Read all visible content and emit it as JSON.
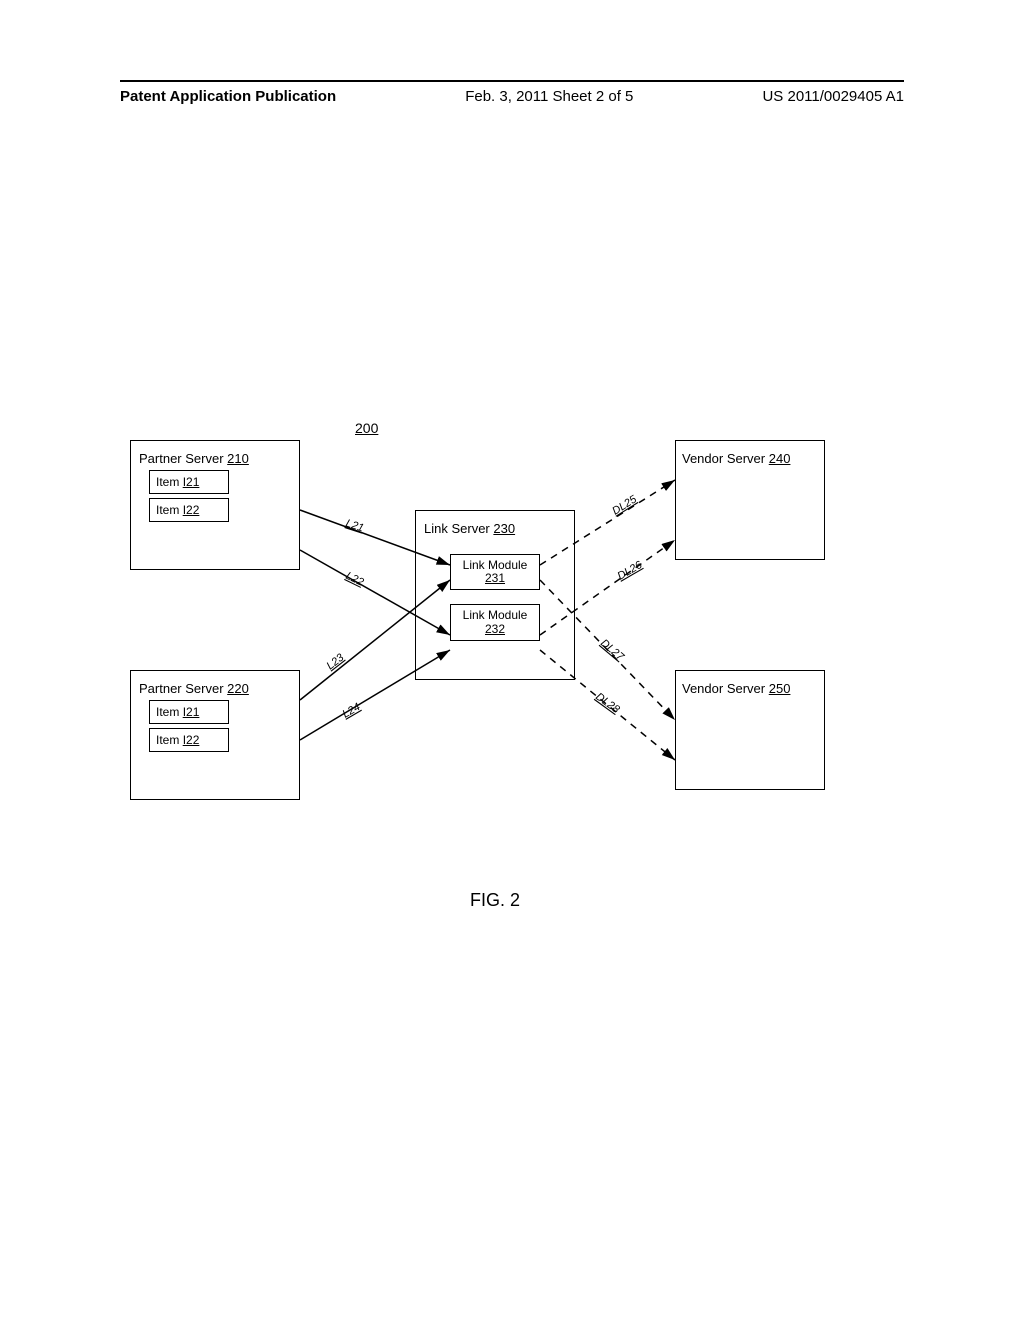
{
  "header": {
    "left": "Patent Application Publication",
    "mid": "Feb. 3, 2011  Sheet 2 of 5",
    "right": "US 2011/0029405 A1"
  },
  "figure": {
    "number": "200",
    "label": "FIG. 2"
  },
  "boxes": {
    "partner210": {
      "title": "Partner Server",
      "num": "210",
      "items": [
        {
          "label": "Item",
          "num": "I21"
        },
        {
          "label": "Item",
          "num": "I22"
        }
      ]
    },
    "partner220": {
      "title": "Partner Server",
      "num": "220",
      "items": [
        {
          "label": "Item",
          "num": "I21"
        },
        {
          "label": "Item",
          "num": "I22"
        }
      ]
    },
    "link230": {
      "title": "Link Server",
      "num": "230",
      "modules": [
        {
          "label": "Link Module",
          "num": "231"
        },
        {
          "label": "Link Module",
          "num": "232"
        }
      ]
    },
    "vendor240": {
      "title": "Vendor Server",
      "num": "240"
    },
    "vendor250": {
      "title": "Vendor Server",
      "num": "250"
    }
  },
  "links": {
    "l21": "L21",
    "l22": "L22",
    "l23": "L23",
    "l24": "L24",
    "dl25": "DL25",
    "dl26": "DL26",
    "dl27": "DL27",
    "dl28": "DL28"
  }
}
